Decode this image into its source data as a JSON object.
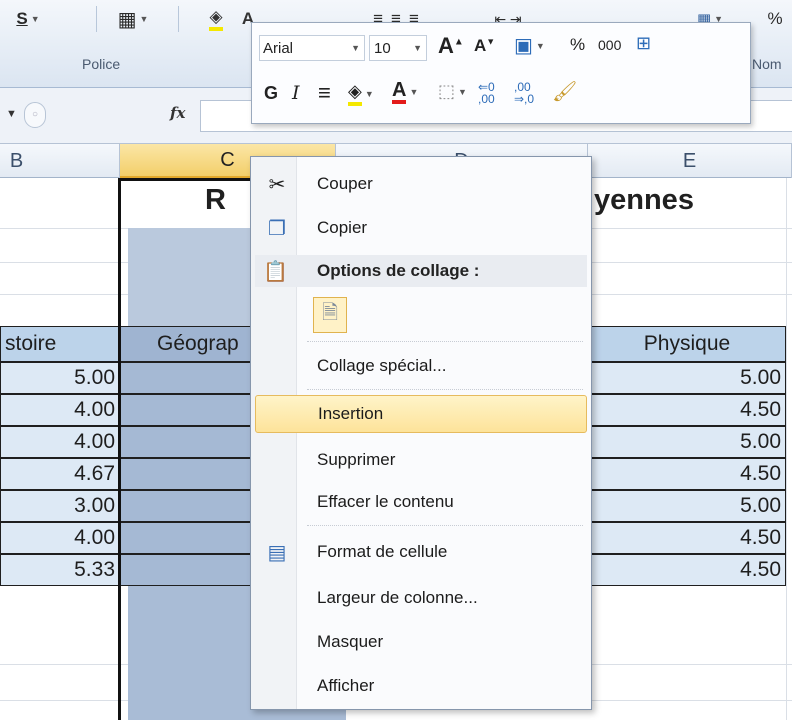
{
  "ribbon": {
    "police_label": "Police",
    "nom_label": "Nom",
    "underline_label": "S",
    "percent_label": "%"
  },
  "mini_toolbar": {
    "font_name": "Arial",
    "font_size": "10",
    "bold_label": "G",
    "italic_label": "I",
    "percent_label": "%",
    "thousands_label": "000"
  },
  "formula_bar": {
    "fx_label": "fx"
  },
  "columns": {
    "B": "B",
    "C": "C",
    "D": "D",
    "E": "E"
  },
  "sheet": {
    "title_left": "R",
    "title_right": "yennes",
    "header_b": "stoire",
    "header_c": "Géograp",
    "header_e": "Physique",
    "rows": [
      {
        "b": "5.00",
        "e": "5.00"
      },
      {
        "b": "4.00",
        "e": "4.50"
      },
      {
        "b": "4.00",
        "e": "5.00"
      },
      {
        "b": "4.67",
        "e": "4.50"
      },
      {
        "b": "3.00",
        "e": "5.00"
      },
      {
        "b": "4.00",
        "e": "4.50"
      },
      {
        "b": "5.33",
        "e": "4.50"
      }
    ]
  },
  "context_menu": {
    "cut": "Couper",
    "copy": "Copier",
    "paste_options": "Options de collage :",
    "paste_special": "Collage spécial...",
    "insert": "Insertion",
    "delete": "Supprimer",
    "clear_contents": "Effacer le contenu",
    "format_cells": "Format de cellule",
    "column_width": "Largeur de colonne...",
    "hide": "Masquer",
    "unhide": "Afficher"
  },
  "colors": {
    "accent_highlight": "#fde39a",
    "selected_column": "#a5b9d4",
    "header_fill": "#bcd3ea",
    "data_fill": "#dde9f5"
  }
}
